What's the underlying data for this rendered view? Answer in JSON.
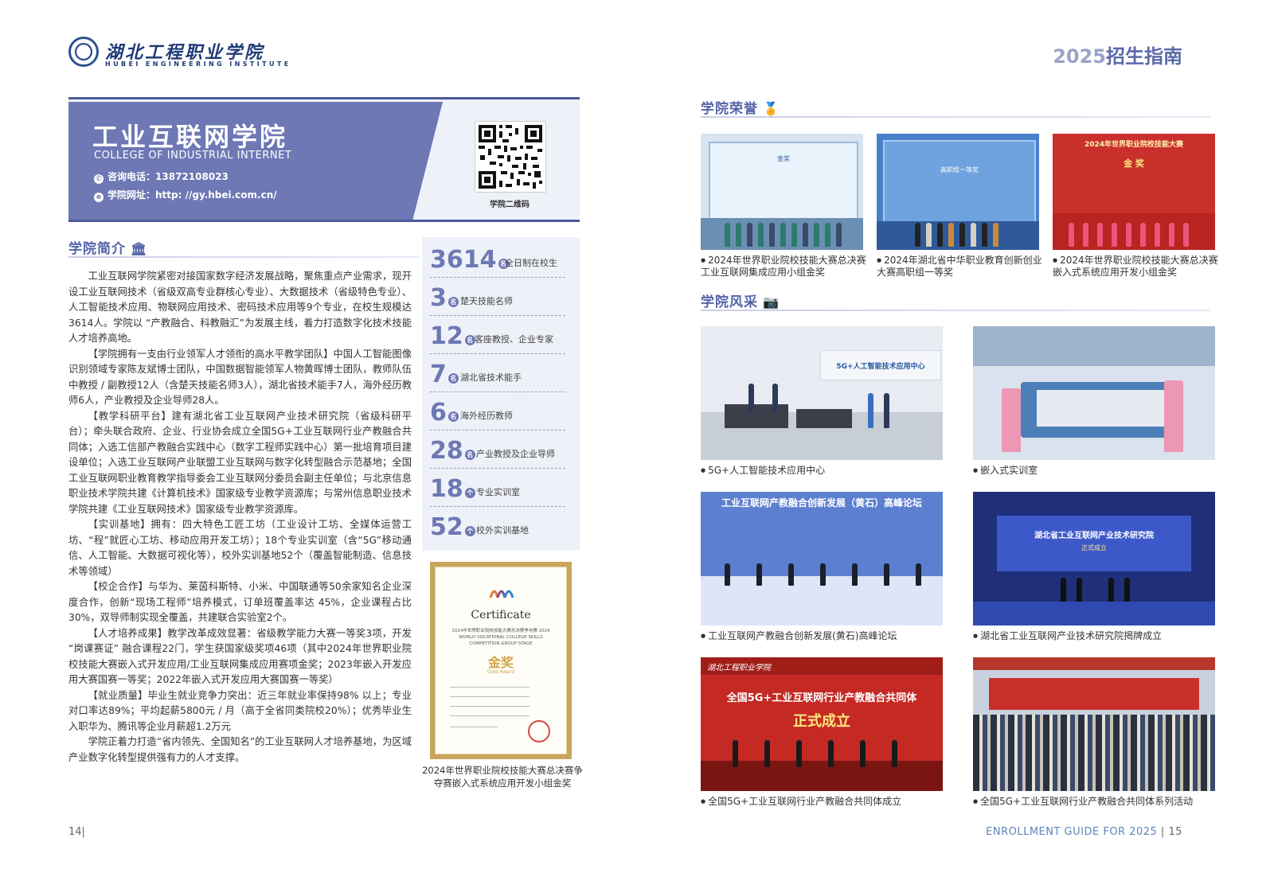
{
  "header": {
    "school_cn": "湖北工程职业学院",
    "school_en": "HUBEI ENGINEERING INSTITUTE",
    "guide_year": "2025",
    "guide_title": "招生指南"
  },
  "banner": {
    "college_cn": "工业互联网学院",
    "college_en": "COLLEGE OF INDUSTRIAL INTERNET",
    "phone_label": "咨询电话：",
    "phone": "13872108023",
    "web_label": "学院网址：",
    "web": "http: //gy.hbei.com.cn/",
    "qr_label": "学院二维码"
  },
  "intro": {
    "heading": "学院简介",
    "paragraphs": [
      "工业互联网学院紧密对接国家数字经济发展战略，聚焦重点产业需求，现开设工业互联网技术（省级双高专业群核心专业）、大数据技术（省级特色专业）、人工智能技术应用、物联网应用技术、密码技术应用等9个专业，在校生规模达3614人。学院以 “产教融合、科教融汇”为发展主线，着力打造数字化技术技能人才培养高地。",
      "【学院拥有一支由行业领军人才领衔的高水平教学团队】中国人工智能图像识别领域专家陈友斌博士团队，中国数据智能领军人物黄晖博士团队，教师队伍中教授 / 副教授12人（含楚天技能名师3人），湖北省技术能手7人，海外经历教师6人，产业教授及企业导师28人。",
      "【教学科研平台】建有湖北省工业互联网产业技术研究院（省级科研平台）；牵头联合政府、企业、行业协会成立全国5G+工业互联网行业产教融合共同体；入选工信部产教融合实践中心（数字工程师实践中心）第一批培育项目建设单位；入选工业互联网产业联盟工业互联网与数字化转型融合示范基地；全国工业互联网职业教育教学指导委会工业互联网分委员会副主任单位；与北京信息职业技术学院共建《计算机技术》国家级专业教学资源库；与常州信息职业技术学院共建《工业互联网技术》国家级专业教学资源库。",
      "【实训基地】拥有：四大特色工匠工坊（工业设计工坊、全媒体运营工坊、“程”就匠心工坊、移动应用开发工坊）；18个专业实训室（含“5G”移动通信、人工智能、大数据可视化等），校外实训基地52个（覆盖智能制造、信息技术等领域）",
      "【校企合作】与华为、莱茵科斯特、小米、中国联通等50余家知名企业深度合作，创新“现场工程师”培养模式，订单班覆盖率达 45%，企业课程占比30%，双导师制实现全覆盖，共建联合实验室2个。",
      "【人才培养成果】教学改革成效显著：省级教学能力大赛一等奖3项，开发 “岗课赛证” 融合课程22门，学生获国家级奖项46项（其中2024年世界职业院校技能大赛嵌入式开发应用/工业互联网集成应用赛项金奖；2023年嵌入开发应用大赛国赛一等奖；2022年嵌入式开发应用大赛国赛一等奖）",
      "【就业质量】毕业生就业竞争力突出：近三年就业率保持98% 以上；专业对口率达89%；平均起薪5800元 / 月（高于全省同类院校20%）；优秀毕业生入职华为、腾讯等企业月薪超1.2万元",
      "学院正着力打造“省内领先、全国知名”的工业互联网人才培养基地，为区域产业数字化转型提供强有力的人才支撑。"
    ]
  },
  "stats": [
    {
      "num": "3614",
      "unit": "名",
      "label": "全日制在校生"
    },
    {
      "num": "3",
      "unit": "名",
      "label": "楚天技能名师"
    },
    {
      "num": "12",
      "unit": "名",
      "label": "客座教授、企业专家"
    },
    {
      "num": "7",
      "unit": "名",
      "label": "湖北省技术能手"
    },
    {
      "num": "6",
      "unit": "名",
      "label": "海外经历教师"
    },
    {
      "num": "28",
      "unit": "名",
      "label": "产业教授及企业导师"
    },
    {
      "num": "18",
      "unit": "个",
      "label": "专业实训室"
    },
    {
      "num": "52",
      "unit": "个",
      "label": "校外实训基地"
    }
  ],
  "certificate": {
    "title": "Certificate",
    "event": "2024年世界职业院校技能大赛总决赛争夺赛 2024 WORLD VOCATIONAL COLLEGE SKILLS COMPETITION GROUP STAGE",
    "award_cn": "金奖",
    "award_en": "Gold Award",
    "caption": "2024年世界职业院校技能大赛总决赛争夺赛嵌入式系统应用开发小组金奖"
  },
  "honors": {
    "heading": "学院荣誉",
    "items": [
      {
        "caption": "2024年世界职业院校技能大赛总决赛工业互联网集成应用小组金奖",
        "screen_text": "金奖"
      },
      {
        "caption": "2024年湖北省中华职业教育创新创业大赛高职组一等奖",
        "screen_text": "高职组一等奖"
      },
      {
        "caption": "2024年世界职业院校技能大赛总决赛嵌入式系统应用开发小组金奖",
        "screen_text": "2024年世界职业院校技能大赛",
        "screen_award": "金 奖"
      }
    ]
  },
  "style": {
    "heading": "学院风采",
    "items": [
      {
        "caption": "5G+人工智能技术应用中心",
        "sign": "5G+人工智能技术应用中心"
      },
      {
        "caption": "嵌入式实训室"
      },
      {
        "caption": "工业互联网产教融合创新发展(黄石)高峰论坛",
        "screen_text": "工业互联网产教融合创新发展（黄石）高峰论坛"
      },
      {
        "caption": "湖北省工业互联网产业技术研究院揭牌成立",
        "screen_text": "湖北省工业互联网产业技术研究院",
        "screen_sub": "正式成立"
      },
      {
        "caption": "全国5G+工业互联网行业产教融合共同体成立",
        "screen_text": "全国5G+工业互联网行业产教融合共同体",
        "screen_sub": "正式成立"
      },
      {
        "caption": "全国5G+工业互联网行业产教融合共同体系列活动"
      }
    ]
  },
  "footer": {
    "page_left": "14",
    "guide_en": "ENROLLMENT GUIDE FOR 2025",
    "page_right": "15"
  },
  "colors": {
    "accent": "#6d78b4",
    "heading": "#5564a8",
    "footer_en": "#5b86b8"
  }
}
